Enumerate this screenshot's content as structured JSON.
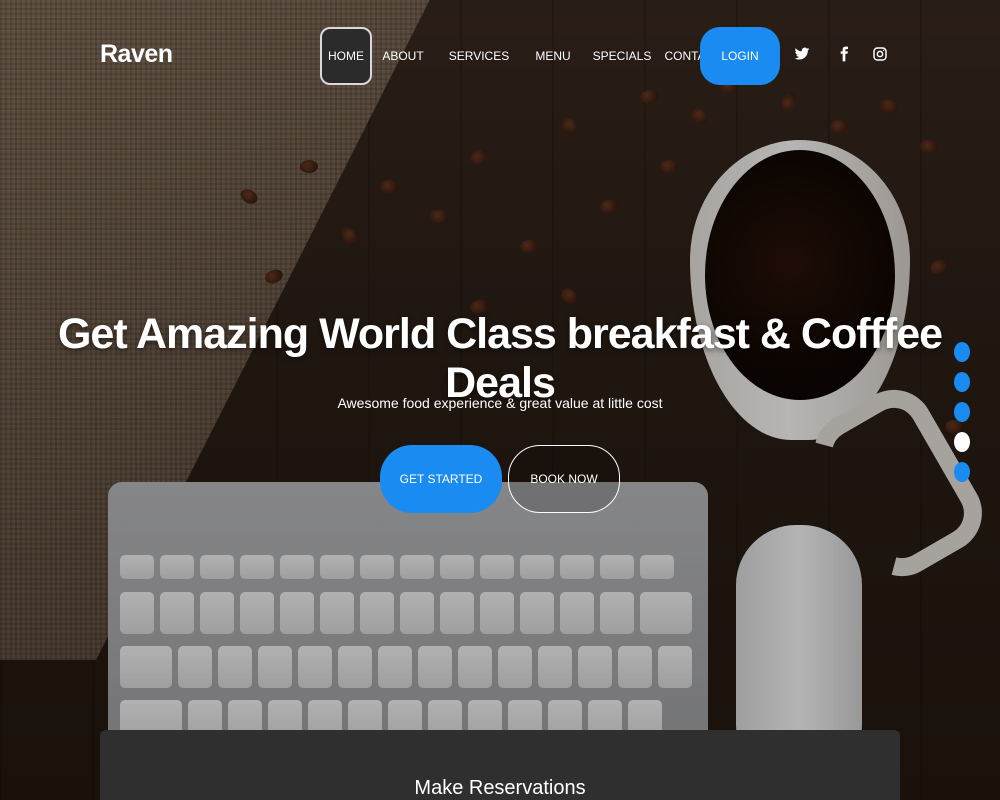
{
  "header": {
    "brand": "Raven",
    "nav": [
      "HOME",
      "ABOUT",
      "SERVICES",
      "MENU",
      "SPECIALS",
      "CONTACT"
    ],
    "active_nav": "HOME",
    "login_label": "LOGIN",
    "social_icons": [
      "twitter-icon",
      "facebook-icon",
      "instagram-icon"
    ]
  },
  "hero": {
    "title": "Get Amazing World Class breakfast & Cofffee Deals",
    "subtitle": "Awesome food experience & great value at little cost",
    "primary_button": "GET STARTED",
    "secondary_button": "BOOK NOW"
  },
  "slider": {
    "count": 5,
    "active_index": 3
  },
  "reservation": {
    "title": "Make Reservations"
  },
  "colors": {
    "accent": "#1a8bf0",
    "panel": "#2f2f2f"
  }
}
